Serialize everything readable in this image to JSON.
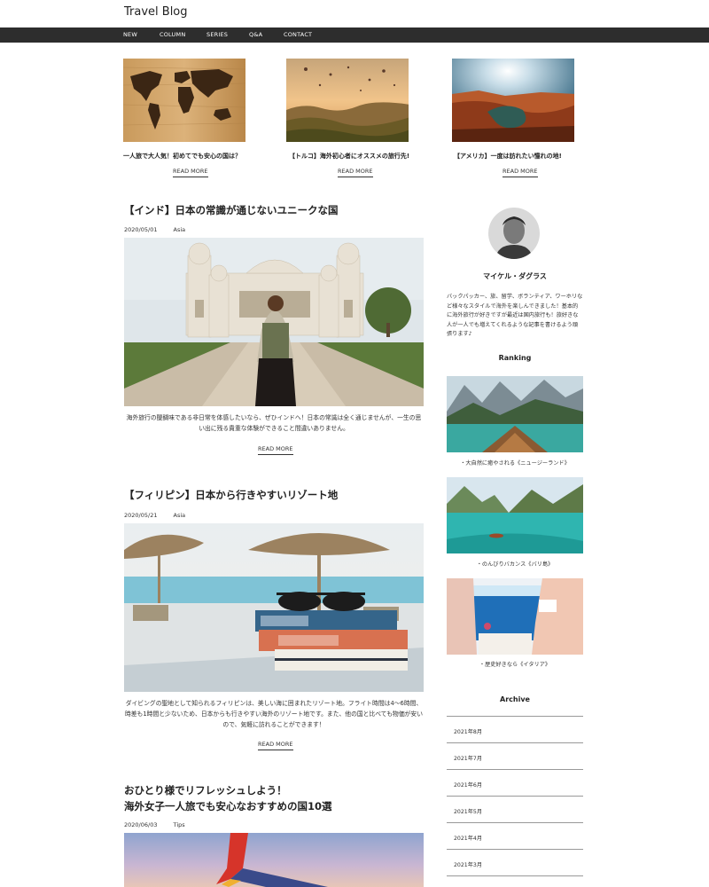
{
  "site": {
    "title": "Travel Blog"
  },
  "nav": {
    "items": [
      "NEW",
      "COLUMN",
      "SERIES",
      "Q&A",
      "CONTACT"
    ]
  },
  "featured": [
    {
      "title": "一人旅で大人気！初めてでも安心の国は？",
      "read_more": "READ MORE",
      "image": "world-map-on-wood"
    },
    {
      "title": "【トルコ】海外初心者にオススメの旅行先!",
      "read_more": "READ MORE",
      "image": "hot-air-balloons-cappadocia"
    },
    {
      "title": "【アメリカ】一度は訪れたい憧れの地!",
      "read_more": "READ MORE",
      "image": "horseshoe-bend-canyon"
    }
  ],
  "posts": [
    {
      "title": "【インド】日本の常識が通じないユニークな国",
      "date": "2020/05/01",
      "category": "Asia",
      "excerpt": "海外旅行の醍醐味である非日常を体感したいなら、ぜひインドへ！日本の常識は全く通じませんが、一生の思い出に残る貴重な体験ができること間違いありません。",
      "read_more": "READ MORE",
      "image": "traveler-at-indian-palace"
    },
    {
      "title": "【フィリピン】日本から行きやすいリゾート地",
      "date": "2020/05/21",
      "category": "Asia",
      "excerpt": "ダイビングの聖地として知られるフィリピンは、美しい海に囲まれたリゾート地。フライト時間は4〜6時間、時差も1時間と少ないため、日本からも行きやすい海外のリゾート地です。また、他の国と比べても物価が安いので、気軽に訪れることができます！",
      "read_more": "READ MORE",
      "image": "books-and-sunglasses-beach"
    },
    {
      "title_line1": "おひとり様でリフレッシュしよう！",
      "title_line2": "海外女子一人旅でも安心なおすすめの国10選",
      "date": "2020/06/03",
      "category": "Tips",
      "image": "airplane-wing-sunset"
    }
  ],
  "sidebar": {
    "author_name": "マイケル・ダグラス",
    "bio": "バックパッカー、旅、留学、ボランティア、ワーホリなど様々なスタイルで海外を楽しんできました！基本的に海外旅行が好きですが最近は国内旅行も！旅好きな人が一人でも増えてくれるような記事を書けるよう頑張ります♪",
    "ranking_heading": "Ranking",
    "ranking": [
      {
        "caption": "・大自然に癒やされる《ニュージーランド》",
        "image": "boat-on-mountain-lake"
      },
      {
        "caption": "・のんびりバカンス《バリ島》",
        "image": "turquoise-lagoon"
      },
      {
        "caption": "・歴史好きなら《イタリア》",
        "image": "coastal-town-sea-view"
      }
    ],
    "archive_heading": "Archive",
    "archive": [
      "2021年8月",
      "2021年7月",
      "2021年6月",
      "2021年5月",
      "2021年4月",
      "2021年3月"
    ]
  },
  "colors": {
    "nav_bg": "#2d2d2d",
    "text": "#222222",
    "divider": "#999999"
  }
}
